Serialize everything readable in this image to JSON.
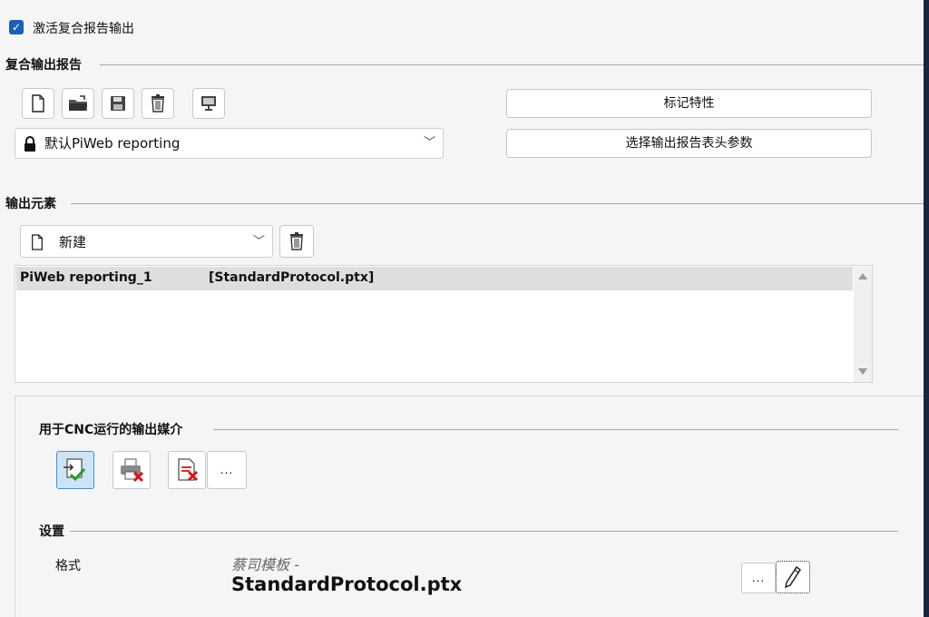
{
  "activate": {
    "checked": true,
    "label": "激活复合报告输出"
  },
  "report_section": {
    "title": "复合输出报告",
    "toolbar": [
      "new-document-icon",
      "open-folder-icon",
      "save-icon",
      "trash-icon",
      "monitor-icon"
    ],
    "combo_value": "默认PiWeb reporting",
    "mark_properties_label": "标记特性",
    "select_header_label": "选择输出报告表头参数"
  },
  "elements_section": {
    "title": "输出元素",
    "combo_value": "新建",
    "list_rows": [
      {
        "name": "PiWeb reporting_1",
        "file": "[StandardProtocol.ptx]"
      }
    ]
  },
  "cnc_section": {
    "title": "用于CNC运行的输出媒介",
    "more_label": "..."
  },
  "settings_section": {
    "title": "设置",
    "format_label": "格式",
    "format_hint": "蔡司模板 -",
    "format_value": "StandardProtocol.ptx",
    "more_label": "..."
  },
  "colors": {
    "accent": "#1a5fb4",
    "selected_row": "#dedede",
    "active_media": "#cde4f7"
  }
}
